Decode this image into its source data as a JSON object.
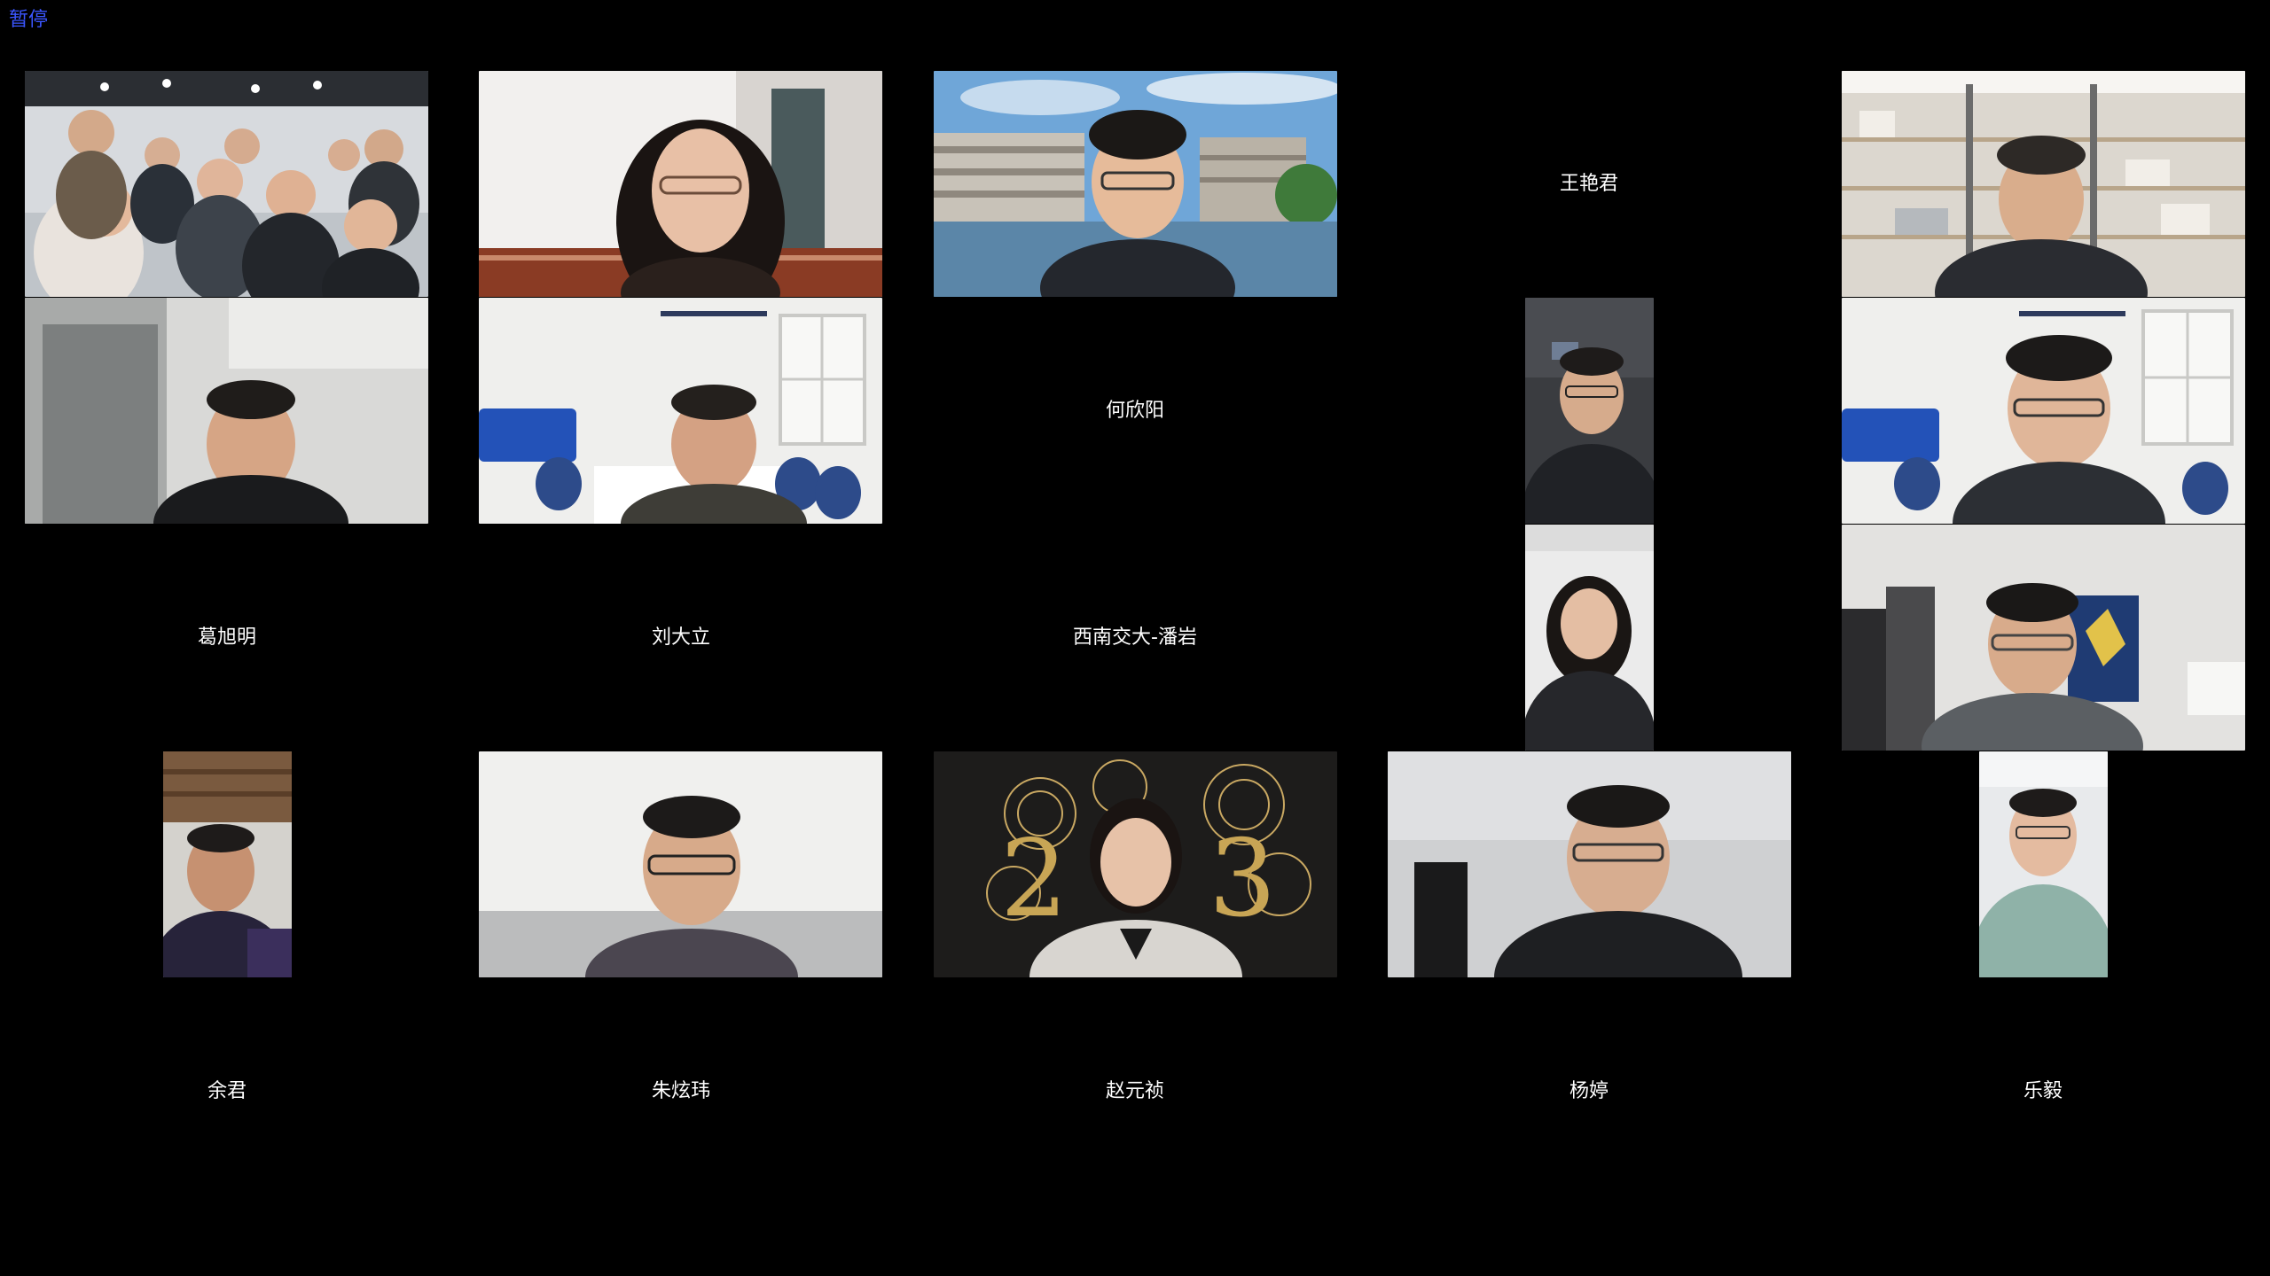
{
  "status": {
    "pause_label": "暂停"
  },
  "participants": [
    {
      "id": "group-photo",
      "type": "video",
      "scene": "group-office"
    },
    {
      "id": "woman-glasses",
      "type": "video",
      "scene": "white-wall-woman"
    },
    {
      "id": "man-campus",
      "type": "video",
      "scene": "campus-background"
    },
    {
      "id": "wang-yanjun",
      "type": "name",
      "name": "王艳君"
    },
    {
      "id": "man-bookshelf",
      "type": "video",
      "scene": "bookshelf"
    },
    {
      "id": "man-white-room",
      "type": "video",
      "scene": "white-room"
    },
    {
      "id": "man-conference-room",
      "type": "video",
      "scene": "conference-room"
    },
    {
      "id": "he-xinyang",
      "type": "name",
      "name": "何欣阳"
    },
    {
      "id": "man-portrait-dark",
      "type": "video",
      "scene": "portrait-dark"
    },
    {
      "id": "man-conference-room-2",
      "type": "video",
      "scene": "conference-room"
    },
    {
      "id": "ge-xuming",
      "type": "name",
      "name": "葛旭明"
    },
    {
      "id": "liu-dali",
      "type": "name",
      "name": "刘大立"
    },
    {
      "id": "xinan-panyan",
      "type": "name",
      "name": "西南交大-潘岩"
    },
    {
      "id": "woman-portrait",
      "type": "video",
      "scene": "portrait-woman"
    },
    {
      "id": "man-hallway",
      "type": "video",
      "scene": "hallway"
    },
    {
      "id": "man-portrait-small",
      "type": "video",
      "scene": "portrait-wood"
    },
    {
      "id": "man-white-wall",
      "type": "video",
      "scene": "white-wall-man"
    },
    {
      "id": "woman-2023",
      "type": "video",
      "scene": "new-year-2023"
    },
    {
      "id": "man-dark-room",
      "type": "video",
      "scene": "dark-room"
    },
    {
      "id": "man-portrait-light",
      "type": "video",
      "scene": "portrait-light"
    },
    {
      "id": "yu-jun",
      "type": "name",
      "name": "余君"
    },
    {
      "id": "zhu-xuanwei",
      "type": "name",
      "name": "朱炫玮"
    },
    {
      "id": "zhao-yuanzhen",
      "type": "name",
      "name": "赵元祯"
    },
    {
      "id": "yang-ting",
      "type": "name",
      "name": "杨婷"
    },
    {
      "id": "le-yi",
      "type": "name",
      "name": "乐毅"
    }
  ],
  "colors": {
    "background": "#000000",
    "pause_text": "#3b56ff",
    "name_text": "#ffffff"
  },
  "icons": {}
}
